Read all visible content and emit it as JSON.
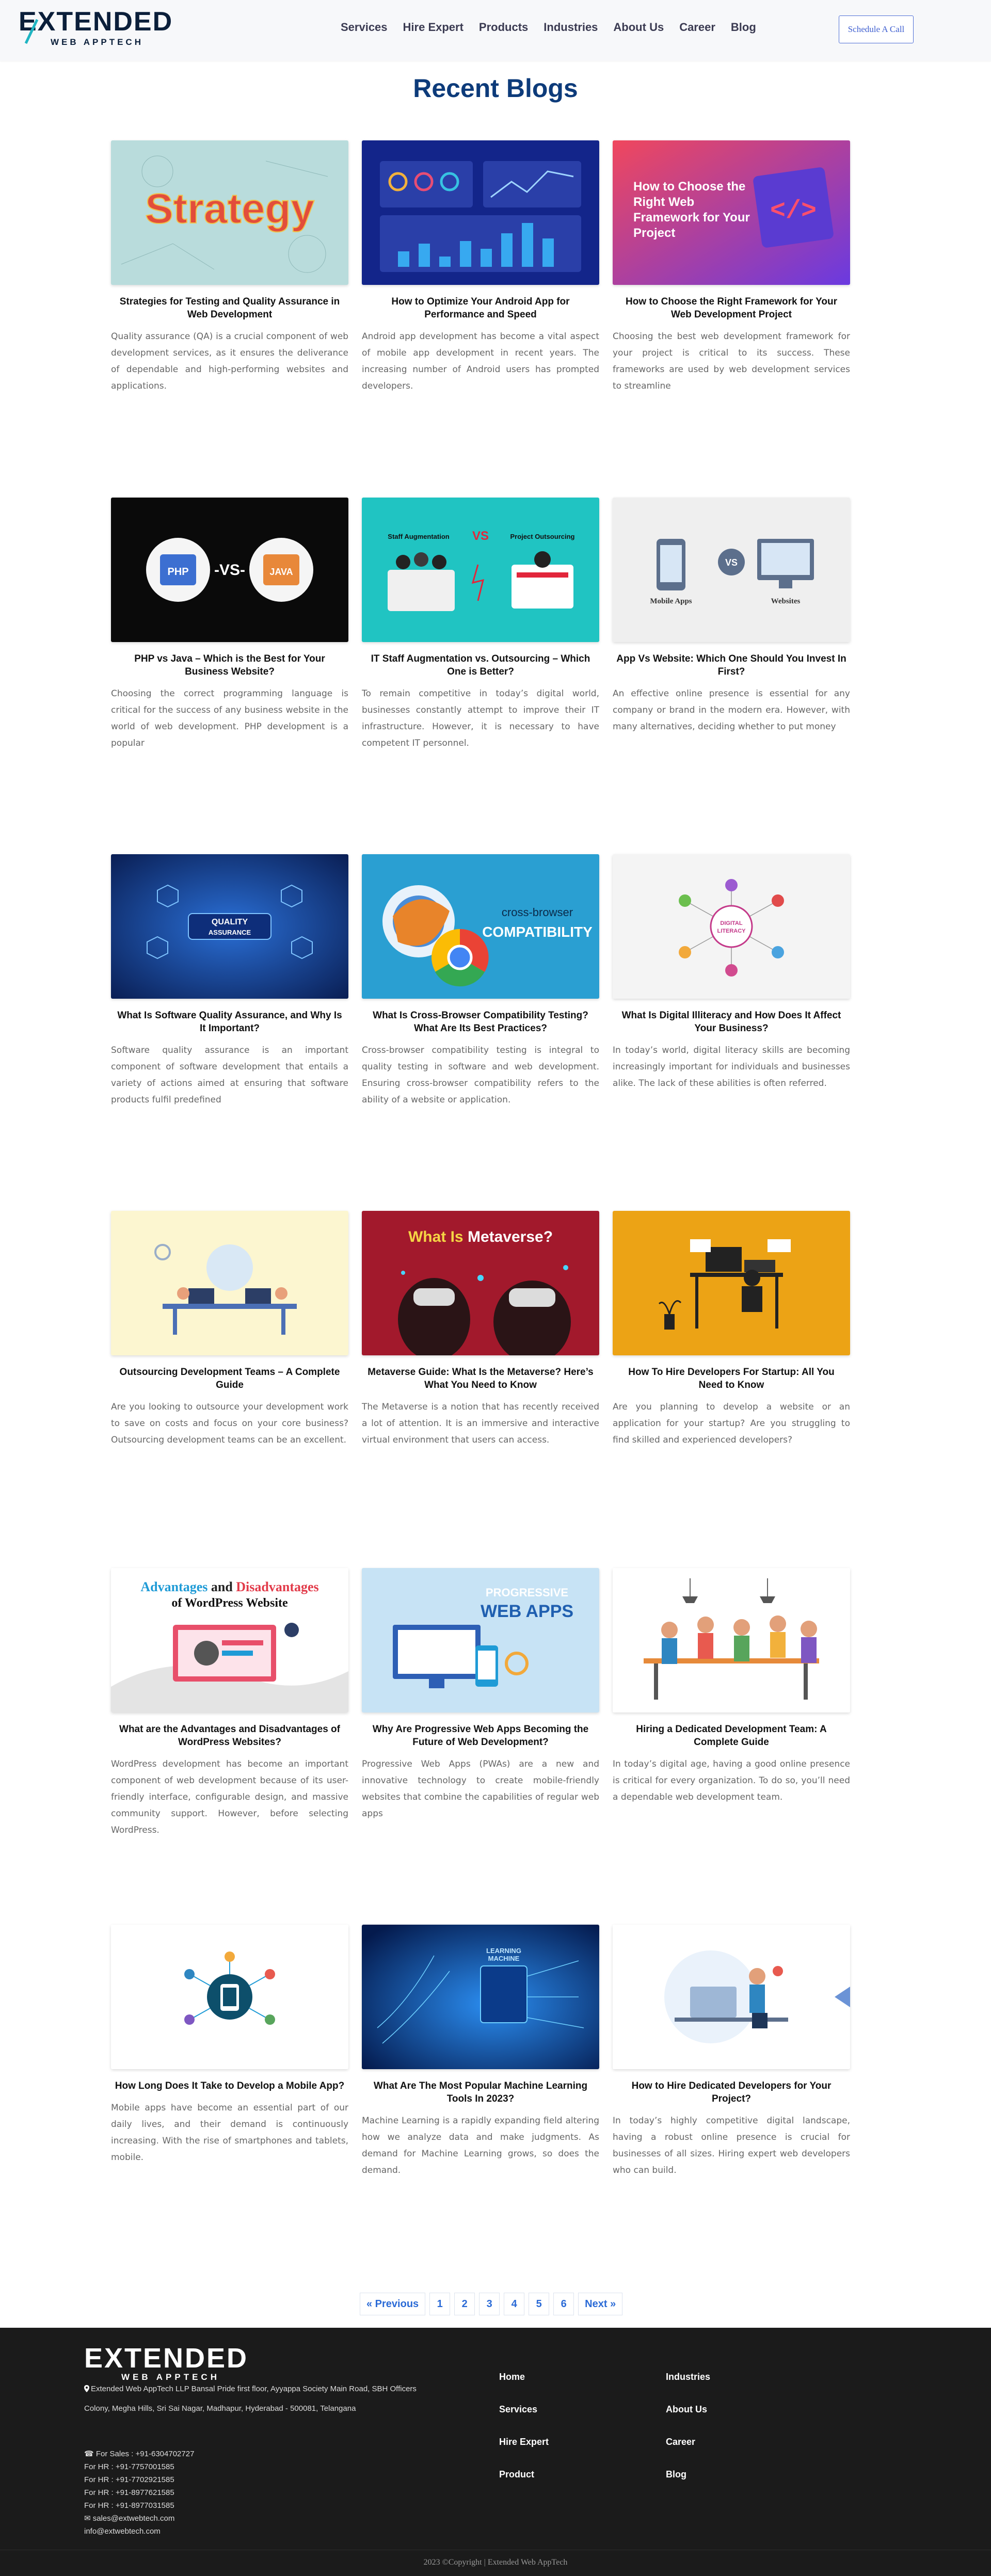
{
  "header": {
    "logo_main": "EXTENDED",
    "logo_sub": "WEB APPTECH",
    "nav": [
      "Services",
      "Hire Expert",
      "Products",
      "Industries",
      "About Us",
      "Career",
      "Blog"
    ],
    "cta": "Schedule A Call"
  },
  "page_title": "Recent Blogs",
  "posts": [
    {
      "title": "Strategies for Testing and Quality Assurance in Web Development",
      "excerpt": "Quality assurance (QA) is a crucial component of web development services, as it ensures the deliverance of dependable and high-performing websites and applications.",
      "image_text": "Strategy"
    },
    {
      "title": "How to Optimize Your Android App for Performance and Speed",
      "excerpt": "Android app development has become a vital aspect of mobile app development in recent years. The increasing number of Android users has prompted developers."
    },
    {
      "title": "How to Choose the Right Framework for Your Web Development Project",
      "excerpt": "Choosing the best web development framework for your project is critical to its success. These frameworks are used by web development services to streamline",
      "image_text": "How to Choose the Right Web Framework for Your Project"
    },
    {
      "title": "PHP vs Java – Which is the Best for Your Business Website?",
      "excerpt": "Choosing the correct programming language is critical for the success of any business website in the world of web development. PHP development is a popular",
      "image_text": [
        "PHP",
        "-VS-",
        "JAVA"
      ]
    },
    {
      "title": "IT Staff Augmentation vs. Outsourcing – Which One is Better?",
      "excerpt": "To remain competitive in today’s digital world, businesses constantly attempt to improve their IT infrastructure. However, it is necessary to have competent IT personnel.",
      "image_text": [
        "Staff Augmentation",
        "VS",
        "Project Outsourcing"
      ]
    },
    {
      "title": "App Vs Website: Which One Should You Invest In First?",
      "excerpt": "An effective online presence is essential for any company or brand in the modern era. However, with many alternatives, deciding whether to put money",
      "image_text": [
        "Mobile Apps",
        "VS",
        "Websites"
      ]
    },
    {
      "title": "What Is Software Quality Assurance, and Why Is It Important?",
      "excerpt": "Software quality assurance is an important component of software development that entails a variety of actions aimed at ensuring that software products fulfil predefined",
      "image_text": [
        "QUALITY",
        "ASSURANCE"
      ]
    },
    {
      "title": "What Is Cross-Browser Compatibility Testing? What Are Its Best Practices?",
      "excerpt": "Cross-browser compatibility testing is integral to quality testing in software and web development. Ensuring cross-browser compatibility refers to the ability of a website or application.",
      "image_text": [
        "cross-browser",
        "COMPATIBILITY"
      ]
    },
    {
      "title": "What Is Digital Illiteracy and How Does It Affect Your Business?",
      "excerpt": "In today’s world, digital literacy skills are becoming increasingly important for individuals and businesses alike. The lack of these abilities is often referred.",
      "image_text": [
        "DIGITAL",
        "LITERACY"
      ]
    },
    {
      "title": "Outsourcing Development Teams – A Complete Guide",
      "excerpt": "Are you looking to outsource your development work to save on costs and focus on your core business? Outsourcing development teams can be an excellent."
    },
    {
      "title": "Metaverse Guide: What Is the Metaverse? Here’s What You Need to Know",
      "excerpt": "The Metaverse is a notion that has recently received a lot of attention. It is an immersive and interactive virtual environment that users can access.",
      "image_text": [
        "What Is ",
        "Metaverse?"
      ]
    },
    {
      "title": "How To Hire Developers For Startup: All You Need to Know",
      "excerpt": "Are you planning to develop a website or an application for your startup? Are you struggling to find skilled and experienced developers?"
    },
    {
      "title": "What are the Advantages and Disadvantages of WordPress Websites?",
      "excerpt": "WordPress development has become an important component of web development because of its user-friendly interface, configurable design, and massive community support. However, before selecting WordPress.",
      "image_text": [
        "Advantages",
        " and ",
        "Disadvantages",
        "of WordPress Website"
      ]
    },
    {
      "title": "Why Are Progressive Web Apps Becoming the Future of Web Development?",
      "excerpt": "Progressive Web Apps (PWAs) are a new and innovative technology to create mobile-friendly websites that combine the capabilities of regular web apps",
      "image_text": [
        "PROGRESSIVE",
        "WEB APPS"
      ]
    },
    {
      "title": "Hiring a Dedicated Development Team: A Complete Guide",
      "excerpt": "In today’s digital age, having a good online presence is critical for every organization. To do so, you’ll need a dependable web development team."
    },
    {
      "title": "How Long Does It Take to Develop a Mobile App?",
      "excerpt": "Mobile apps have become an essential part of our daily lives, and their demand is continuously increasing. With the rise of smartphones and tablets, mobile."
    },
    {
      "title": "What Are The Most Popular Machine Learning Tools In 2023?",
      "excerpt": "Machine Learning is a rapidly expanding field altering how we analyze data and make judgments. As demand for Machine Learning grows, so does the demand.",
      "image_text": [
        "MACHINE",
        "LEARNING"
      ]
    },
    {
      "title": "How to Hire Dedicated Developers for Your Project?",
      "excerpt": "In today’s highly competitive digital landscape, having a robust online presence is crucial for businesses of all sizes. Hiring expert web developers who can build."
    }
  ],
  "pagination": [
    "« Previous",
    "1",
    "2",
    "3",
    "4",
    "5",
    "6",
    "Next »"
  ],
  "footer": {
    "logo_main": "EXTENDED",
    "logo_sub": "WEB APPTECH",
    "address": "Extended Web AppTech LLP Bansal Pride first floor, Ayyappa Society Main Road, SBH Officers Colony, Megha Hills, Sri Sai Nagar, Madhapur, Hyderabad - 500081, Telangana",
    "contacts": [
      "For Sales : +91-6304702727",
      "For HR : +91-7757001585",
      "For HR : +91-7702921585",
      "For HR : +91-8977621585",
      "For HR : +91-8977031585",
      "sales@extwebtech.com",
      "info@extwebtech.com"
    ],
    "col1": [
      "Home",
      "Services",
      "Hire Expert",
      "Product"
    ],
    "col2": [
      "Industries",
      "About Us",
      "Career",
      "Blog"
    ],
    "copyright": "2023 ©Copyright | Extended Web AppTech"
  },
  "colors": {
    "brand_dark": "#0b1f3a",
    "accent_blue": "#0d3b7a",
    "link_blue": "#2a6ad6",
    "teal": "#1fb5c2",
    "footer_bg": "#1b1b1b"
  }
}
